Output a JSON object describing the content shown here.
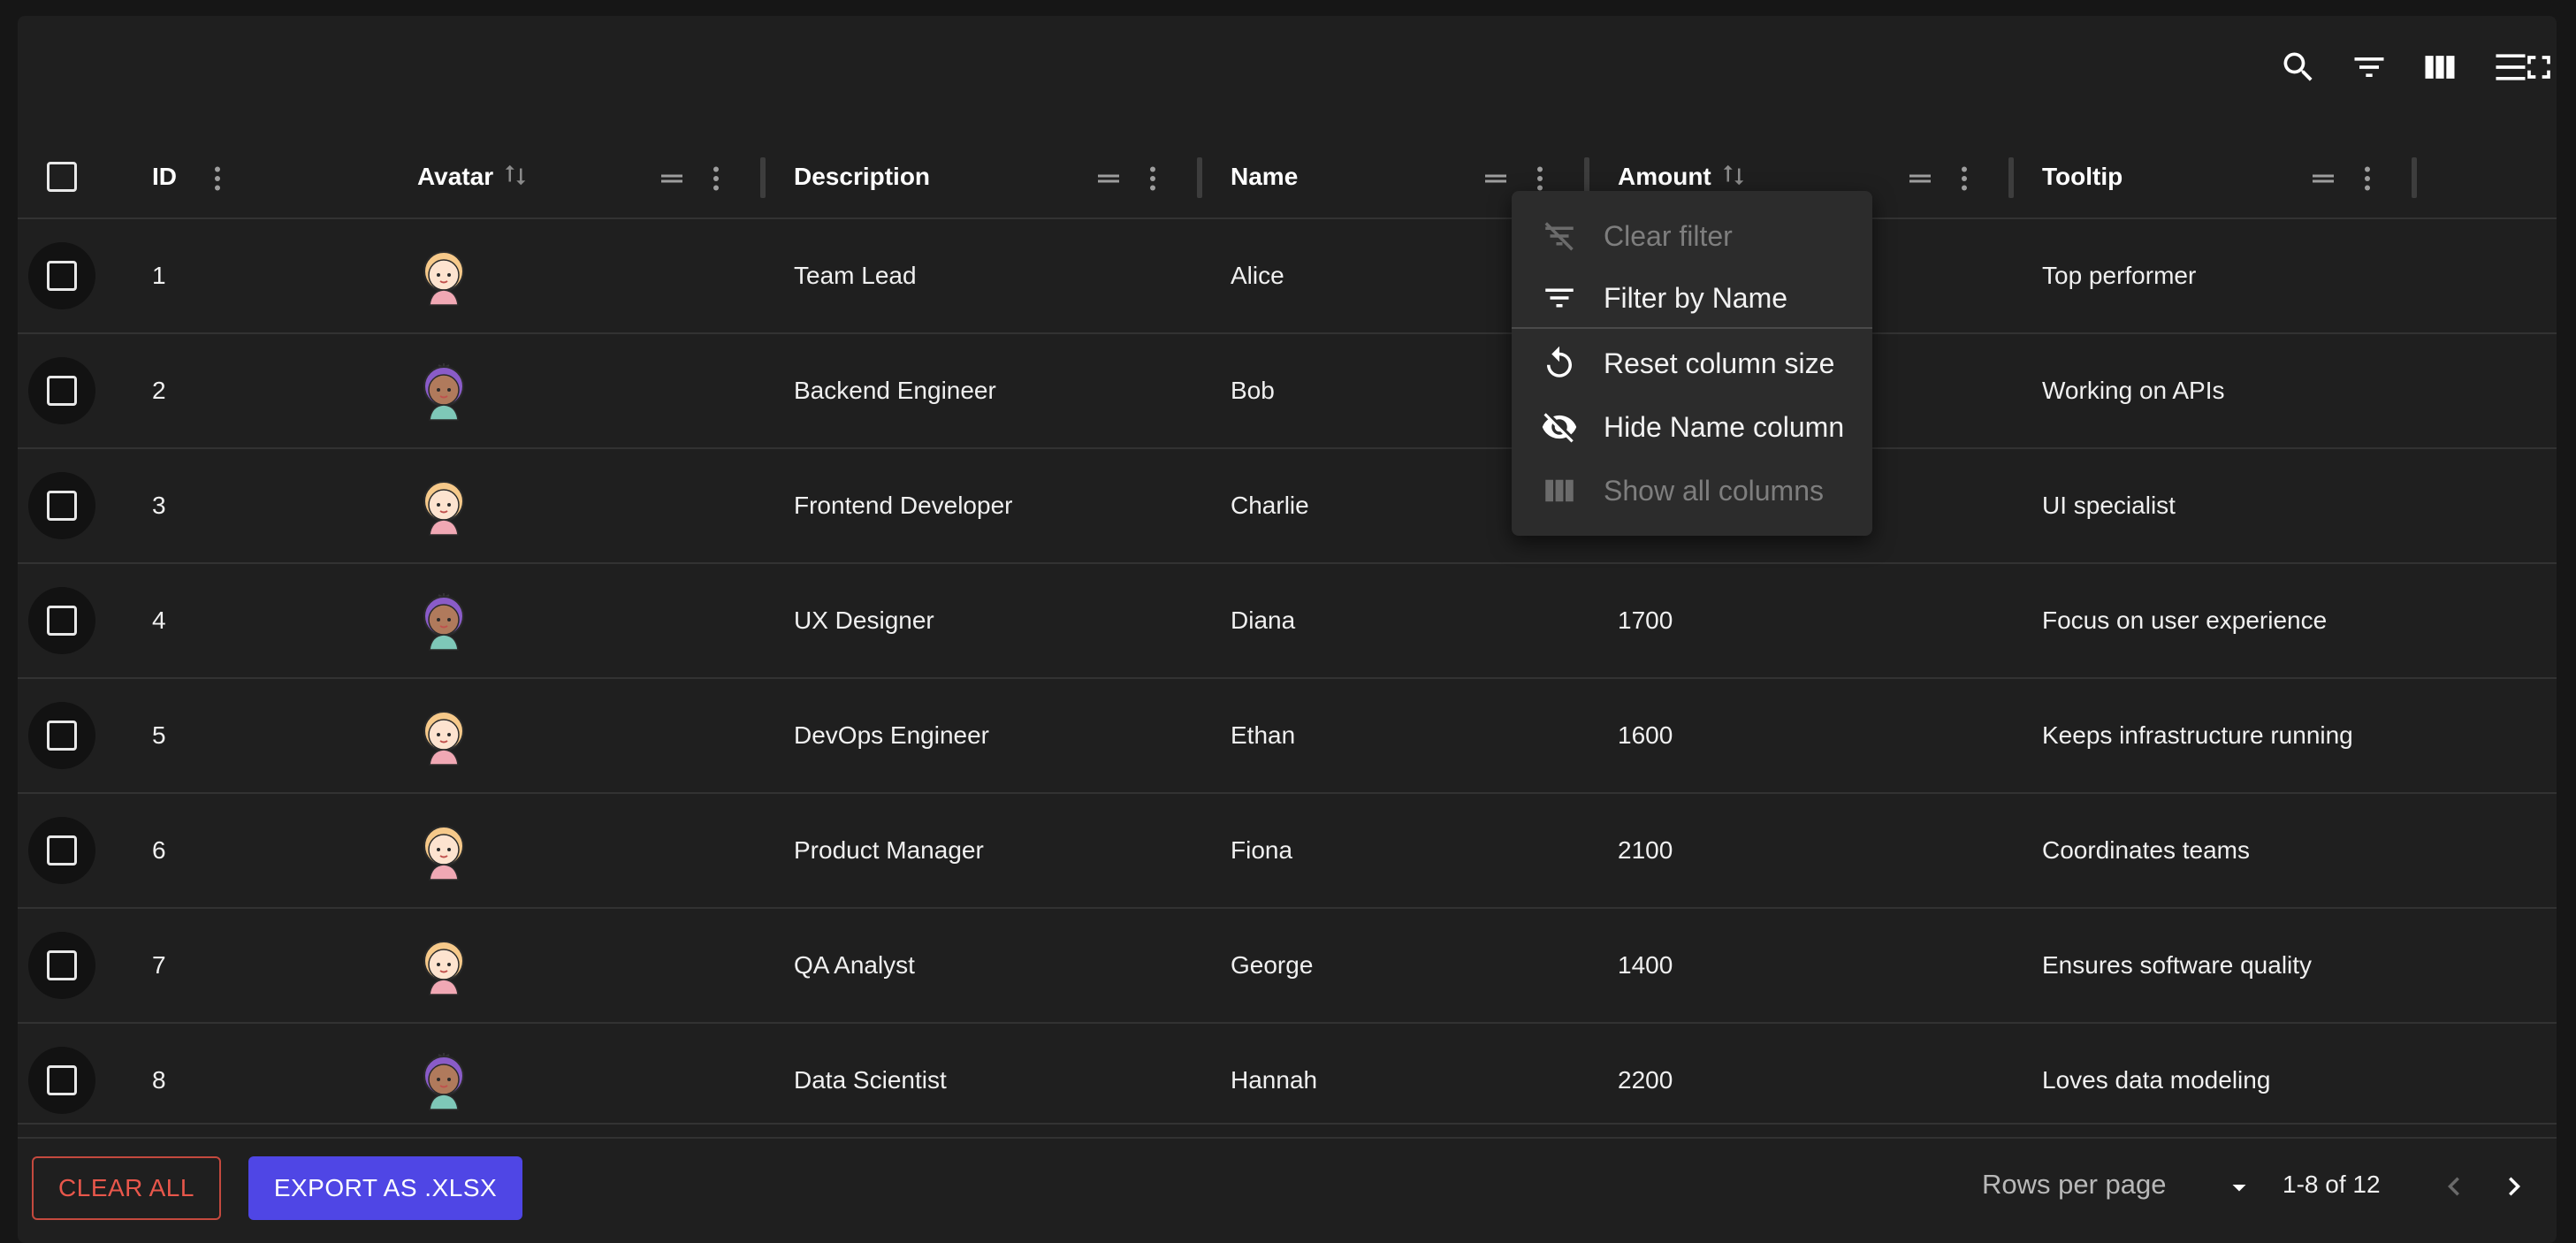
{
  "toolbar": {
    "icons": [
      "search-icon",
      "filter-list-icon",
      "view-column-icon",
      "density-icon",
      "fullscreen-icon"
    ]
  },
  "columns": {
    "id": "ID",
    "avatar": "Avatar",
    "description": "Description",
    "name": "Name",
    "amount": "Amount",
    "tooltip": "Tooltip"
  },
  "rows": [
    {
      "id": "1",
      "avatar": "avatar-light",
      "description": "Team Lead",
      "name": "Alice",
      "amount": "",
      "tooltip": "Top performer"
    },
    {
      "id": "2",
      "avatar": "avatar-purple",
      "description": "Backend Engineer",
      "name": "Bob",
      "amount": "",
      "tooltip": "Working on APIs"
    },
    {
      "id": "3",
      "avatar": "avatar-light",
      "description": "Frontend Developer",
      "name": "Charlie",
      "amount": "",
      "tooltip": "UI specialist"
    },
    {
      "id": "4",
      "avatar": "avatar-purple",
      "description": "UX Designer",
      "name": "Diana",
      "amount": "1700",
      "tooltip": "Focus on user experience"
    },
    {
      "id": "5",
      "avatar": "avatar-light",
      "description": "DevOps Engineer",
      "name": "Ethan",
      "amount": "1600",
      "tooltip": "Keeps infrastructure running"
    },
    {
      "id": "6",
      "avatar": "avatar-light",
      "description": "Product Manager",
      "name": "Fiona",
      "amount": "2100",
      "tooltip": "Coordinates teams"
    },
    {
      "id": "7",
      "avatar": "avatar-light",
      "description": "QA Analyst",
      "name": "George",
      "amount": "1400",
      "tooltip": "Ensures software quality"
    },
    {
      "id": "8",
      "avatar": "avatar-purple",
      "description": "Data Scientist",
      "name": "Hannah",
      "amount": "2200",
      "tooltip": "Loves data modeling"
    }
  ],
  "column_menu": {
    "clear_filter": "Clear filter",
    "filter_by_name": "Filter by Name",
    "reset_column_size": "Reset column size",
    "hide_name_column": "Hide Name column",
    "show_all_columns": "Show all columns"
  },
  "footer": {
    "clear_all": "CLEAR ALL",
    "export": "EXPORT AS .XLSX",
    "rows_per_page_label": "Rows per page",
    "range": "1-8 of 12"
  },
  "colors": {
    "background": "#1f1f1f",
    "export_button": "#4f46e5",
    "clear_button": "#e8574b",
    "menu_background": "#2c2c2c"
  }
}
